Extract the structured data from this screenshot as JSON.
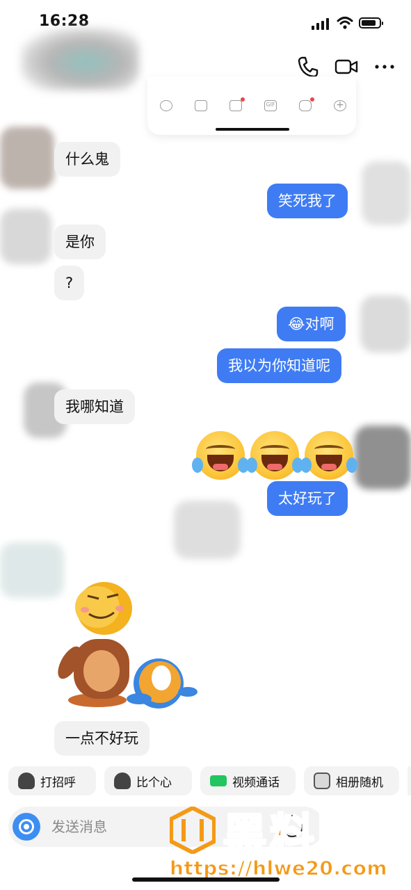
{
  "status_bar": {
    "time": "16:28",
    "battery_level": 0.85
  },
  "header": {
    "icons": [
      "phone-icon",
      "video-call-icon",
      "more-icon"
    ]
  },
  "toolbar_card": {
    "icons": [
      "mic-icon",
      "photo-icon",
      "gift-icon",
      "gif-icon",
      "game-icon",
      "plus-icon"
    ],
    "gif_text": "GIF"
  },
  "messages": [
    {
      "side": "in",
      "text": "什么鬼"
    },
    {
      "side": "out",
      "text": "笑死我了"
    },
    {
      "side": "in",
      "text": "是你"
    },
    {
      "side": "in",
      "text": "?"
    },
    {
      "side": "out",
      "text": "对啊",
      "emoji": "😂"
    },
    {
      "side": "out",
      "text": "我以为你知道呢"
    },
    {
      "side": "in",
      "text": "我哪知道"
    },
    {
      "side": "out",
      "emoji_count": 3
    },
    {
      "side": "out",
      "text": "太好玩了"
    },
    {
      "side": "in",
      "sticker": "cartoon-sticker"
    },
    {
      "side": "in",
      "text": "一点不好玩"
    }
  ],
  "quick_actions": [
    {
      "label": "打招呼",
      "icon": "wave-avatar-icon"
    },
    {
      "label": "比个心",
      "icon": "heart-avatar-icon"
    },
    {
      "label": "视频通话",
      "icon": "video-icon",
      "color": "#22c55e"
    },
    {
      "label": "相册随机",
      "icon": "dice-icon"
    }
  ],
  "input": {
    "placeholder": "发送消息"
  },
  "watermark": {
    "brand": "黑料网",
    "url": "https://hlwe20.com",
    "color": "#f39a17"
  },
  "colors": {
    "outgoing": "#3f7cf4",
    "incoming": "#f1f1f1",
    "camera": "#3d8ef2"
  }
}
